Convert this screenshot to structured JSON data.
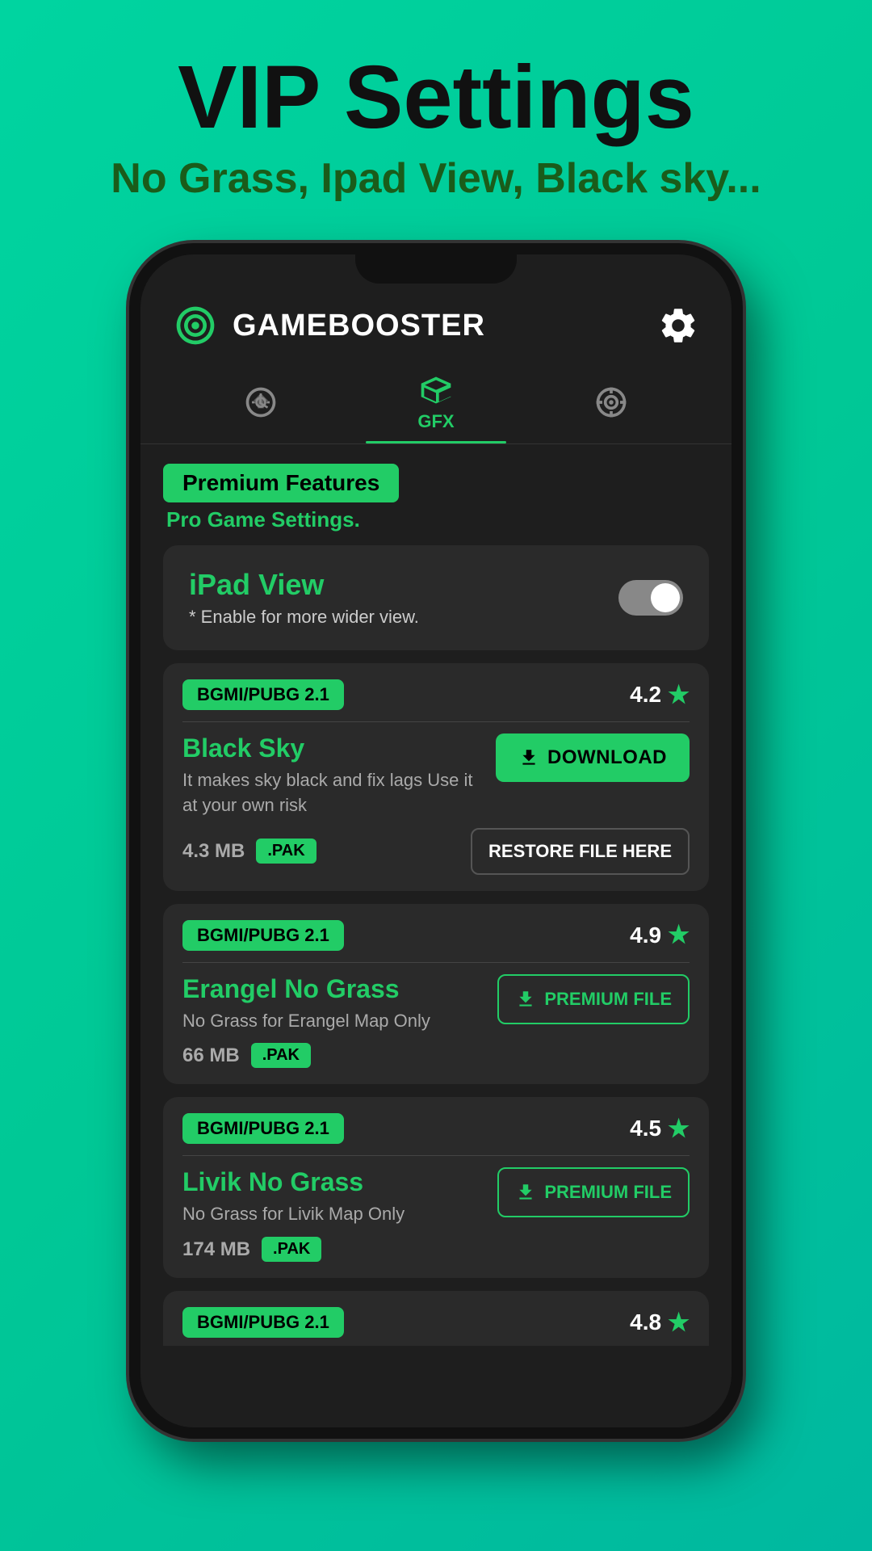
{
  "header": {
    "title": "VIP Settings",
    "subtitle": "No Grass, Ipad View, Black sky..."
  },
  "app": {
    "name": "GAMEBOOSTER"
  },
  "tabs": [
    {
      "id": "speed",
      "label": "",
      "active": false
    },
    {
      "id": "gfx",
      "label": "GFX",
      "active": true
    },
    {
      "id": "aim",
      "label": "",
      "active": false
    }
  ],
  "premium": {
    "badge": "Premium Features",
    "subtitle": "Pro Game Settings."
  },
  "ipad_view": {
    "title": "iPad View",
    "description": "* Enable for more wider view.",
    "enabled": false
  },
  "files": [
    {
      "version": "BGMI/PUBG 2.1",
      "rating": "4.2",
      "name": "Black Sky",
      "description": "It makes sky black and fix lags\nUse it at your own risk",
      "size": "4.3 MB",
      "extension": ".PAK",
      "button_type": "download",
      "button_label": "DOWNLOAD",
      "restore_label": "RESTORE FILE HERE"
    },
    {
      "version": "BGMI/PUBG 2.1",
      "rating": "4.9",
      "name": "Erangel No Grass",
      "description": "No Grass for Erangel Map Only",
      "size": "66 MB",
      "extension": ".PAK",
      "button_type": "premium",
      "button_label": "PREMIUM FILE",
      "restore_label": ""
    },
    {
      "version": "BGMI/PUBG 2.1",
      "rating": "4.5",
      "name": "Livik No Grass",
      "description": "No Grass for Livik Map Only",
      "size": "174 MB",
      "extension": ".PAK",
      "button_type": "premium",
      "button_label": "PREMIUM FILE",
      "restore_label": ""
    },
    {
      "version": "BGMI/PUBG 2.1",
      "rating": "4.8",
      "name": "",
      "description": "",
      "size": "",
      "extension": "",
      "button_type": "premium",
      "button_label": "",
      "restore_label": ""
    }
  ],
  "colors": {
    "green": "#22cc66",
    "dark_bg": "#1e1e1e",
    "card_bg": "#2a2a2a"
  }
}
